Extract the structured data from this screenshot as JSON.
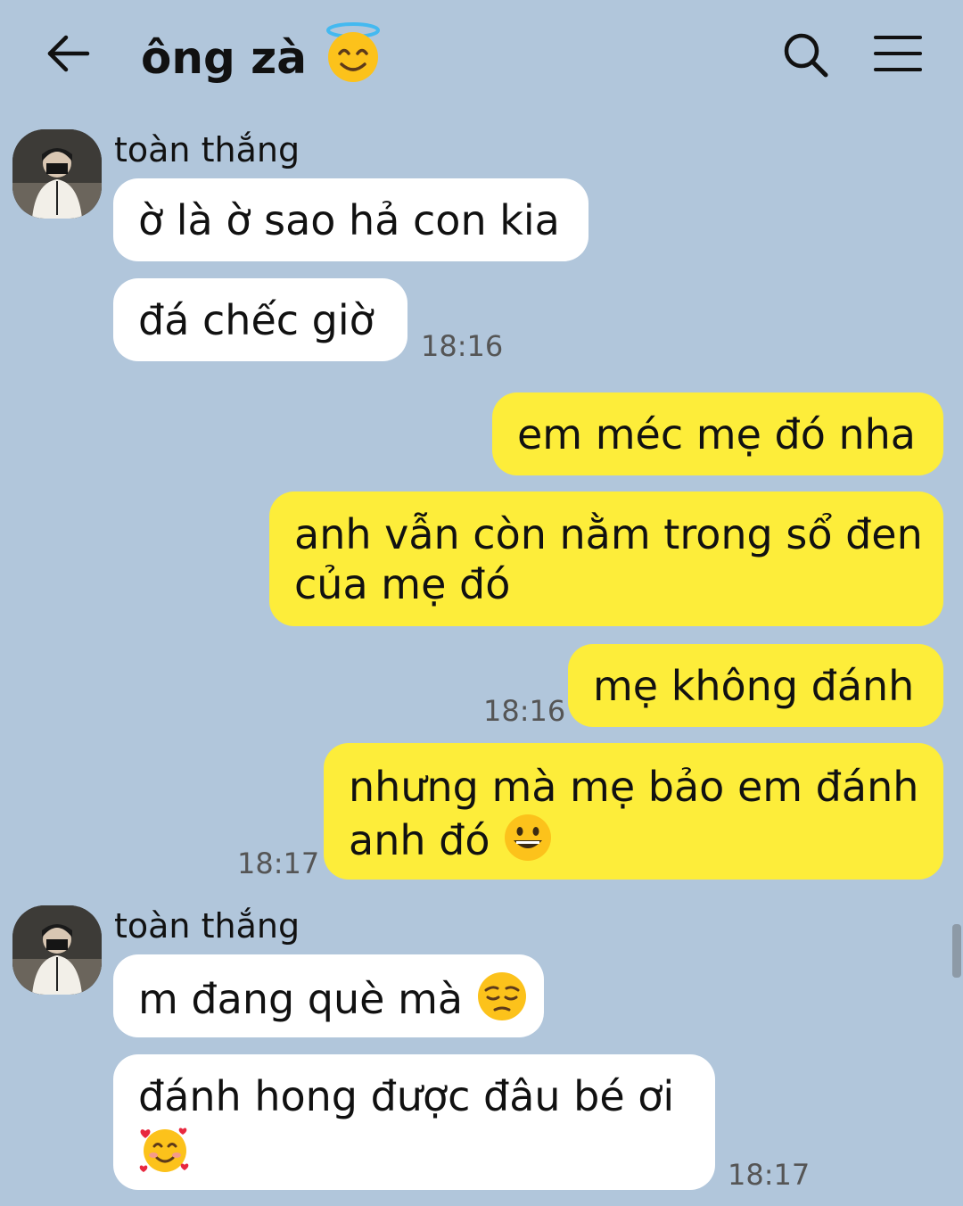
{
  "header": {
    "title": "ông zà",
    "title_emoji_icon": "halo-smile-emoji-icon"
  },
  "messages": {
    "group1": {
      "sender": "toàn thắng",
      "bubble1": "ờ là ờ sao hả con kia",
      "bubble2": "đá chếc giờ",
      "time": "18:16"
    },
    "outgoing": {
      "bubble1": "em méc mẹ đó nha",
      "bubble2_line1": "anh vẫn còn nằm trong sổ đen",
      "bubble2_line2": "của mẹ đó",
      "bubble3": "mẹ không đánh",
      "time1": "18:16",
      "bubble4_line1": "nhưng mà mẹ bảo em đánh",
      "bubble4_line2": "anh đó",
      "time2": "18:17"
    },
    "group2": {
      "sender": "toàn thắng",
      "bubble1": "m đang què mà",
      "bubble2_line1": "đánh hong được đâu bé ơi",
      "time": "18:17"
    }
  },
  "colors": {
    "background": "#b1c6db",
    "incoming_bubble": "#ffffff",
    "outgoing_bubble": "#fded3a"
  }
}
